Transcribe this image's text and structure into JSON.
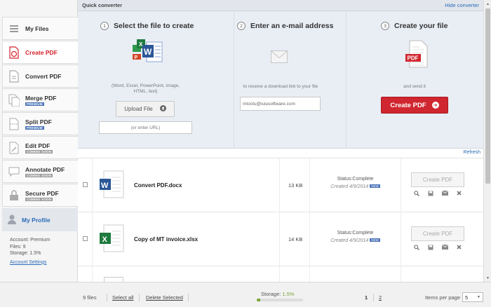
{
  "sidebar": {
    "items": [
      {
        "label": "My Files",
        "badge": ""
      },
      {
        "label": "Create PDF",
        "badge": ""
      },
      {
        "label": "Convert PDF",
        "badge": ""
      },
      {
        "label": "Merge PDF",
        "badge": "PREMIUM"
      },
      {
        "label": "Split PDF",
        "badge": "PREMIUM"
      },
      {
        "label": "Edit PDF",
        "badge": "COMING SOON"
      },
      {
        "label": "Annotate PDF",
        "badge": "COMING SOON"
      },
      {
        "label": "Secure PDF",
        "badge": "COMING SOON"
      }
    ],
    "profile_label": "My Profile",
    "account": {
      "type": "Account: Premium",
      "files": "Files: 9",
      "storage": "Storage: 1.5%",
      "settings_link": "Account Settings"
    }
  },
  "converter": {
    "title": "Quick converter",
    "hide_link": "Hide converter",
    "step1": {
      "num": "1",
      "title": "Select the file to create",
      "desc_1": "(Word, Excel, PowerPoint, image,",
      "desc_2": "HTML, text)",
      "upload_label": "Upload File",
      "url_placeholder": "(or enter URL)"
    },
    "step2": {
      "num": "2",
      "title": "Enter an e-mail address",
      "desc": "to receive a download link to your file",
      "email_value": "mtoctu@iuiusoftware.com"
    },
    "step3": {
      "num": "3",
      "title": "Create your file",
      "desc": "and send it",
      "button_label": "Create PDF"
    }
  },
  "refresh_label": "Refresh",
  "files": [
    {
      "name": "Convert PDF.docx",
      "size": "13 KB",
      "status": "Status:Complete",
      "created": "Created 4/9/2014",
      "new": "NEW",
      "action": "Create PDF",
      "type": "word"
    },
    {
      "name": "Copy of MT invoice.xlsx",
      "size": "14 KB",
      "status": "Status:Complete",
      "created": "Created 4/9/2014",
      "new": "NEW",
      "action": "Create PDF",
      "type": "excel"
    }
  ],
  "footer": {
    "count": "9 files",
    "select_all": "Select all",
    "delete_selected": "Delete Selected",
    "storage_label": "Storage:",
    "storage_value": "1.5%",
    "storage_fraction": 0.015,
    "page1": "1",
    "page2": "2",
    "items_per_page_label": "Items per page",
    "items_per_page_value": "5"
  },
  "colors": {
    "accent": "#d0262f",
    "link": "#2a6cb8",
    "badge": "#4a72b8",
    "storage": "#7aa63a"
  }
}
